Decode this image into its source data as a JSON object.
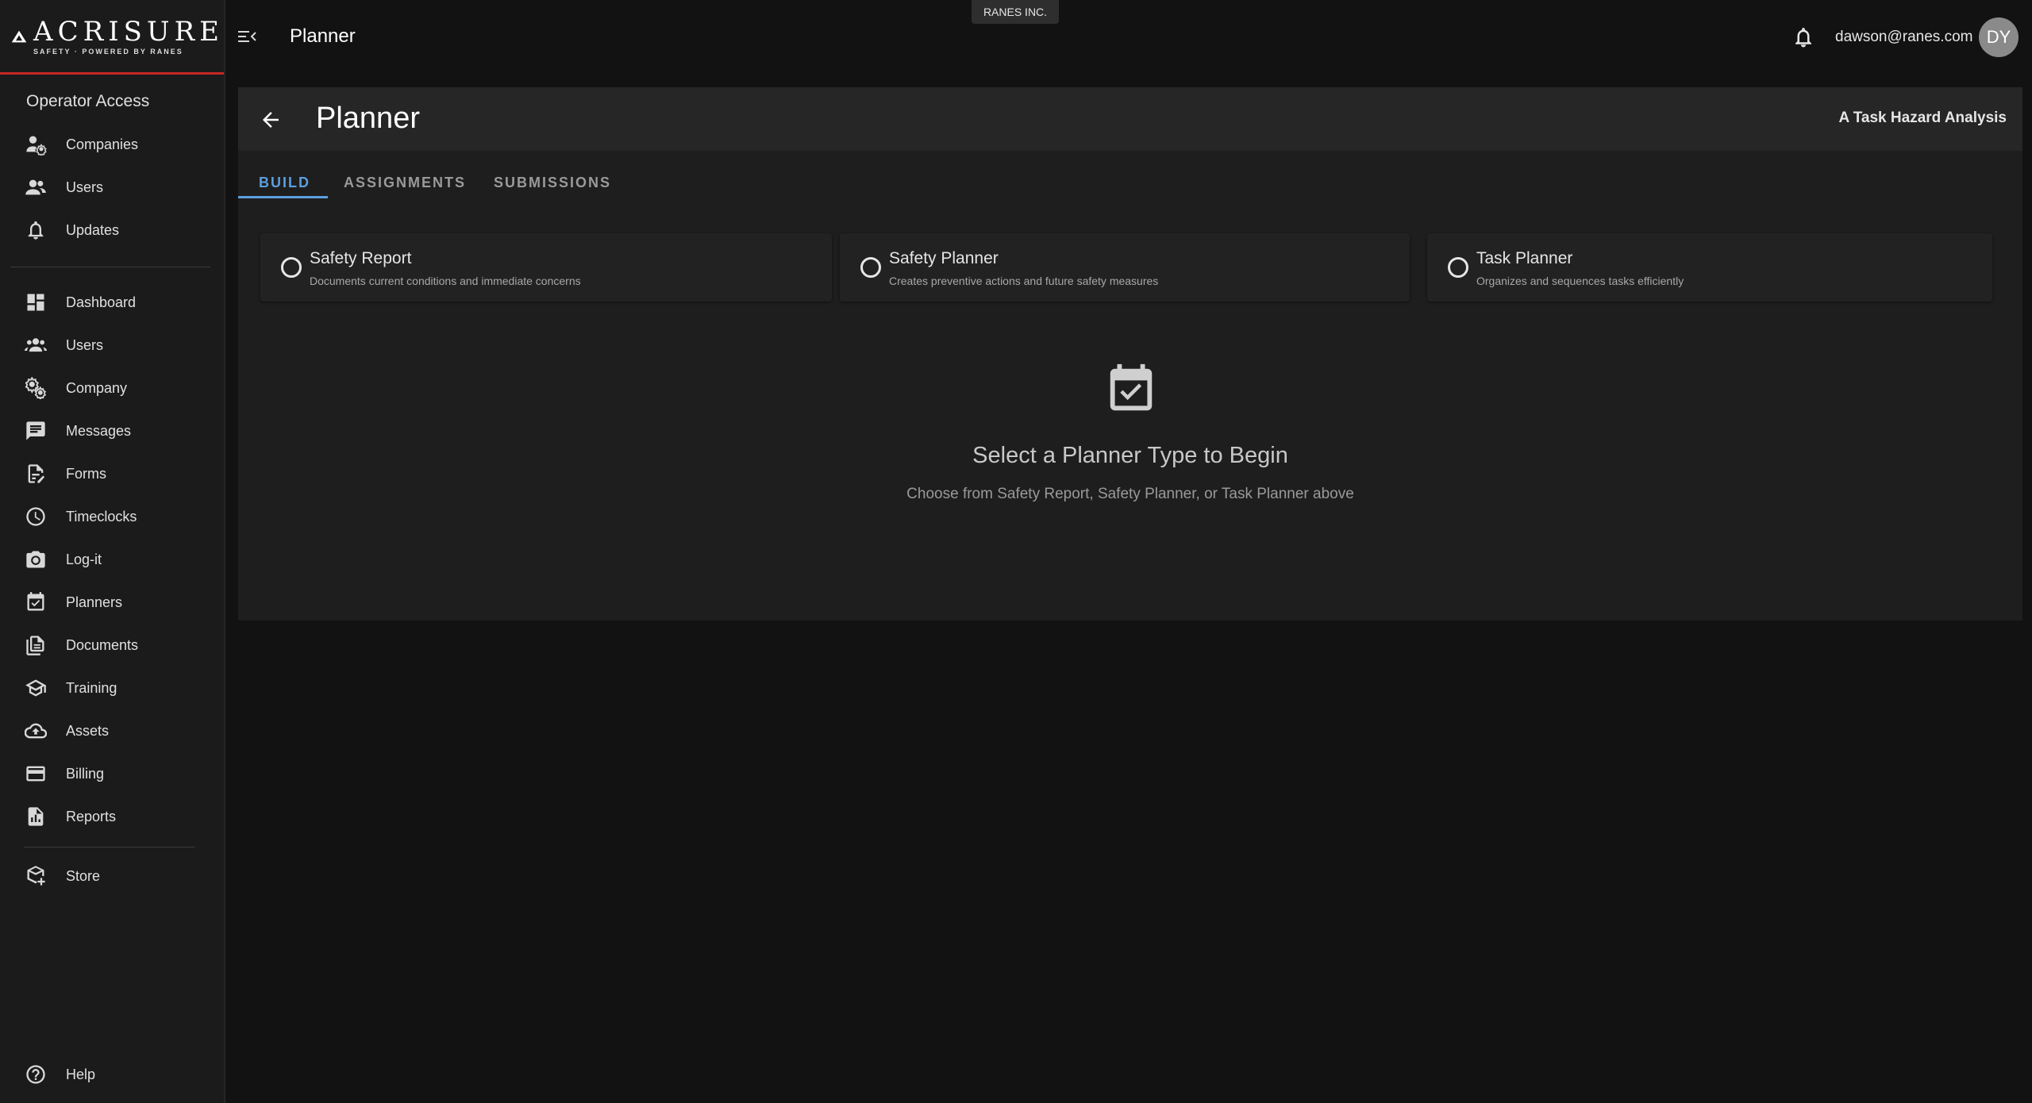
{
  "brand": {
    "name": "ACRISURE",
    "tagline": "SAFETY · POWERED BY RANES"
  },
  "sidebar": {
    "section_title": "Operator Access",
    "operator_items": [
      {
        "label": "Companies",
        "icon": "companies-icon"
      },
      {
        "label": "Users",
        "icon": "users-icon"
      },
      {
        "label": "Updates",
        "icon": "bell-icon"
      }
    ],
    "main_items": [
      {
        "label": "Dashboard",
        "icon": "dashboard-icon"
      },
      {
        "label": "Users",
        "icon": "group-icon"
      },
      {
        "label": "Company",
        "icon": "settings-icon"
      },
      {
        "label": "Messages",
        "icon": "message-icon"
      },
      {
        "label": "Forms",
        "icon": "form-edit-icon"
      },
      {
        "label": "Timeclocks",
        "icon": "clock-icon"
      },
      {
        "label": "Log-it",
        "icon": "camera-icon"
      },
      {
        "label": "Planners",
        "icon": "calendar-check-icon"
      },
      {
        "label": "Documents",
        "icon": "documents-icon"
      },
      {
        "label": "Training",
        "icon": "school-icon"
      },
      {
        "label": "Assets",
        "icon": "cloud-upload-icon"
      },
      {
        "label": "Billing",
        "icon": "credit-card-icon"
      },
      {
        "label": "Reports",
        "icon": "report-icon"
      }
    ],
    "store": {
      "label": "Store",
      "icon": "store-icon"
    },
    "help": {
      "label": "Help",
      "icon": "help-icon"
    }
  },
  "topbar": {
    "title": "Planner",
    "company": "RANES INC.",
    "email": "dawson@ranes.com",
    "avatar_initials": "DY"
  },
  "panel": {
    "title": "Planner",
    "subtitle": "A Task Hazard Analysis",
    "tabs": [
      {
        "label": "BUILD",
        "active": true
      },
      {
        "label": "ASSIGNMENTS",
        "active": false
      },
      {
        "label": "SUBMISSIONS",
        "active": false
      }
    ],
    "options": [
      {
        "title": "Safety Report",
        "desc": "Documents current conditions and immediate concerns"
      },
      {
        "title": "Safety Planner",
        "desc": "Creates preventive actions and future safety measures"
      },
      {
        "title": "Task Planner",
        "desc": "Organizes and sequences tasks efficiently"
      }
    ],
    "empty": {
      "title": "Select a Planner Type to Begin",
      "desc": "Choose from Safety Report, Safety Planner, or Task Planner above"
    }
  },
  "colors": {
    "accent": "#5b9fe0",
    "brand_red": "#c62828",
    "background": "#121212"
  }
}
